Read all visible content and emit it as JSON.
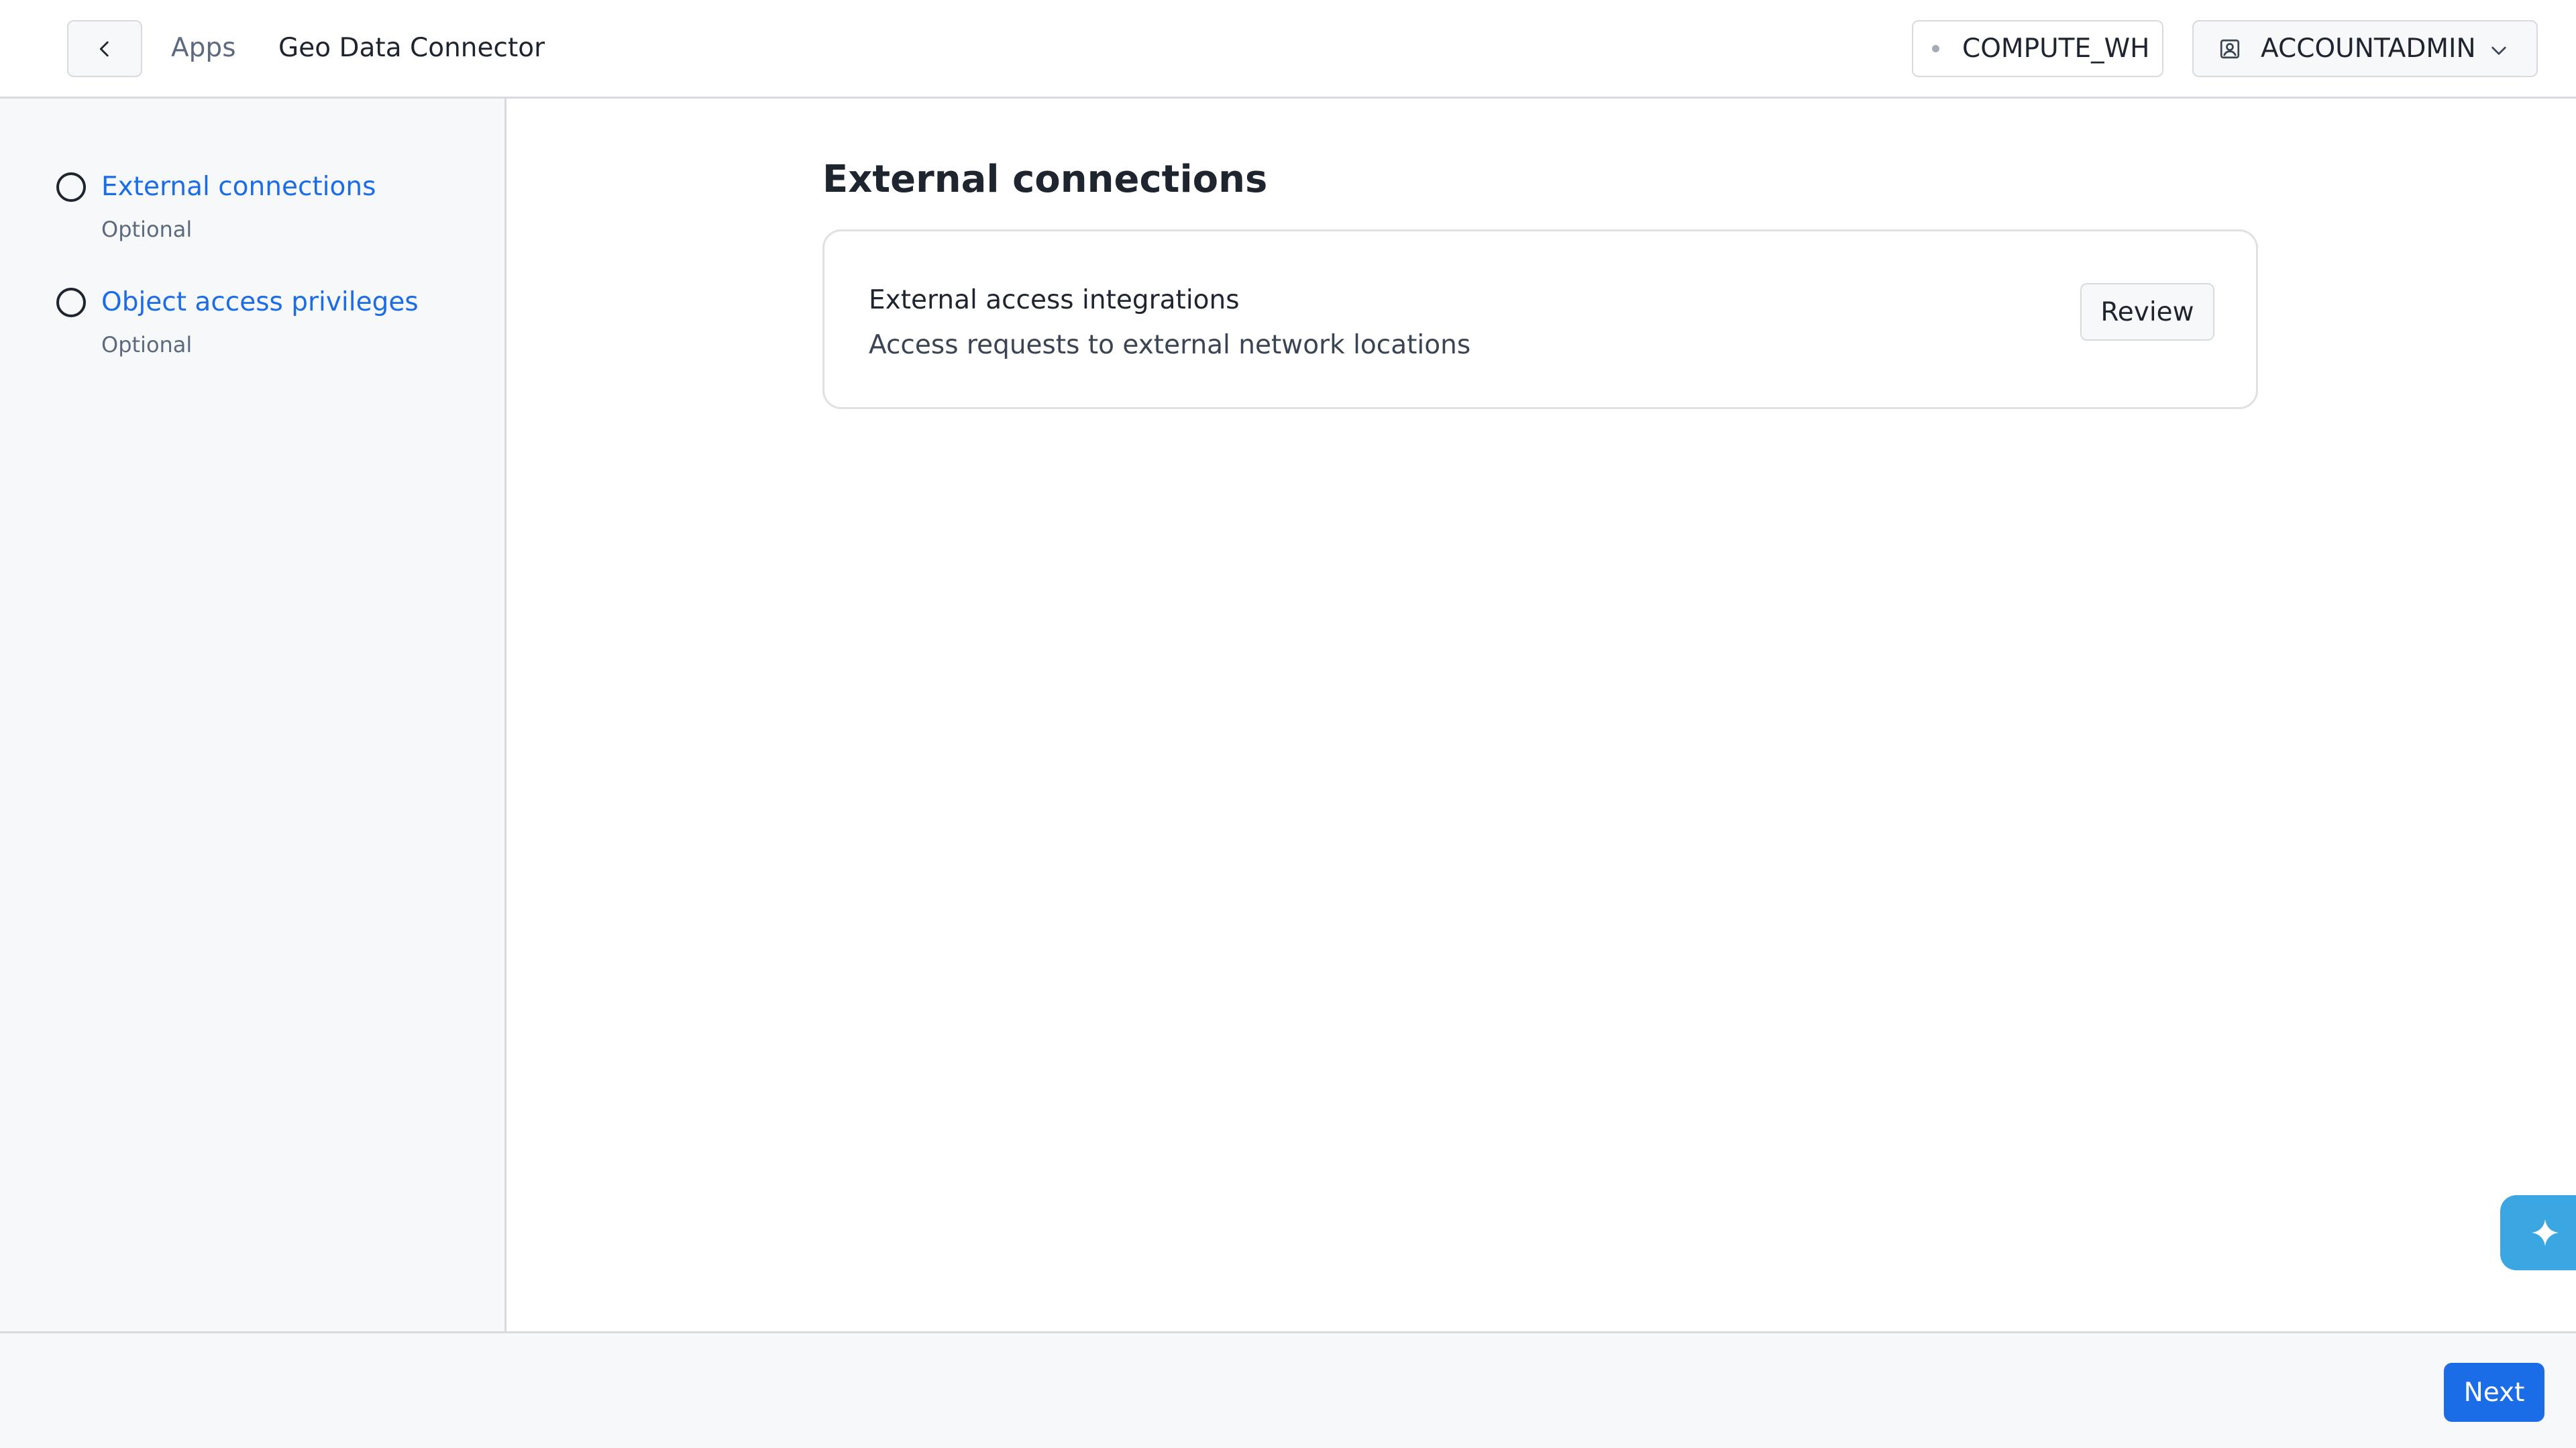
{
  "header": {
    "breadcrumb_parent": "Apps",
    "breadcrumb_current": "Geo Data Connector",
    "warehouse_label": "COMPUTE_WH",
    "role_label": "ACCOUNTADMIN"
  },
  "sidebar": {
    "steps": [
      {
        "title": "External connections",
        "subtitle": "Optional"
      },
      {
        "title": "Object access privileges",
        "subtitle": "Optional"
      }
    ]
  },
  "main": {
    "title": "External connections",
    "card": {
      "title": "External access integrations",
      "description": "Access requests to external network locations",
      "action_label": "Review"
    }
  },
  "footer": {
    "next_label": "Next"
  },
  "icons": {
    "back": "chevron-left-icon",
    "warehouse_status": "status-dot-icon",
    "role": "user-badge-icon",
    "role_dropdown": "chevron-down-icon",
    "assistant": "sparkle-icon"
  },
  "colors": {
    "link": "#1a6ce7",
    "primary_button": "#1a6ce7",
    "assistant": "#3aa7e3",
    "sidebar_bg": "#f7f8f9",
    "border": "#d8dadf"
  }
}
